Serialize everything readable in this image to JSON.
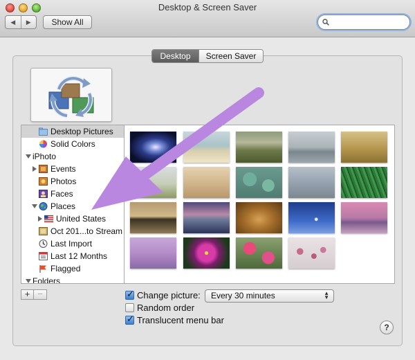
{
  "window": {
    "title": "Desktop & Screen Saver"
  },
  "toolbar": {
    "back_glyph": "◀",
    "forward_glyph": "▶",
    "show_all_label": "Show All"
  },
  "search": {
    "value": "",
    "placeholder": ""
  },
  "tabs": [
    {
      "label": "Desktop",
      "active": true
    },
    {
      "label": "Screen Saver",
      "active": false
    }
  ],
  "sidebar": {
    "items": [
      {
        "label": "Desktop Pictures",
        "icon": "folder-icon",
        "selected": true
      },
      {
        "label": "Solid Colors",
        "icon": "color-wheel-icon"
      },
      {
        "label": "iPhoto",
        "disclosure": "open"
      },
      {
        "label": "Events",
        "icon": "events-icon",
        "disclosure": "closed"
      },
      {
        "label": "Photos",
        "icon": "photos-icon"
      },
      {
        "label": "Faces",
        "icon": "faces-icon"
      },
      {
        "label": "Places",
        "icon": "globe-icon",
        "disclosure": "open"
      },
      {
        "label": "United States",
        "icon": "us-flag-icon",
        "disclosure": "closed"
      },
      {
        "label": "Oct 201...to Stream",
        "icon": "photostream-icon"
      },
      {
        "label": "Last Import",
        "icon": "import-icon"
      },
      {
        "label": "Last 12 Months",
        "icon": "calendar-icon"
      },
      {
        "label": "Flagged",
        "icon": "flag-icon"
      },
      {
        "label": "Folders",
        "disclosure": "open"
      }
    ]
  },
  "list_buttons": {
    "add": "+",
    "remove": "−"
  },
  "options": {
    "change_picture": {
      "label": "Change picture:",
      "checked": true
    },
    "interval": "Every 30 minutes",
    "random_order": {
      "label": "Random order",
      "checked": false
    },
    "translucent_menu_bar": {
      "label": "Translucent menu bar",
      "checked": true
    }
  },
  "help_label": "?",
  "thumbnails": [
    "galaxy",
    "beach",
    "grass-field",
    "foggy-lake",
    "golden-field",
    "elephant",
    "zebras",
    "lily-pads",
    "misty-lake",
    "green-grass",
    "island-sunset",
    "mountain-lake",
    "lion",
    "moon",
    "mount-fuji",
    "purple-hills",
    "lotus-flower",
    "pink-flowers",
    "blossom-branch"
  ],
  "colors": {
    "annotation_arrow": "#b987e0",
    "selection": "#d3d3d3",
    "accent": "#3a7fd2"
  }
}
